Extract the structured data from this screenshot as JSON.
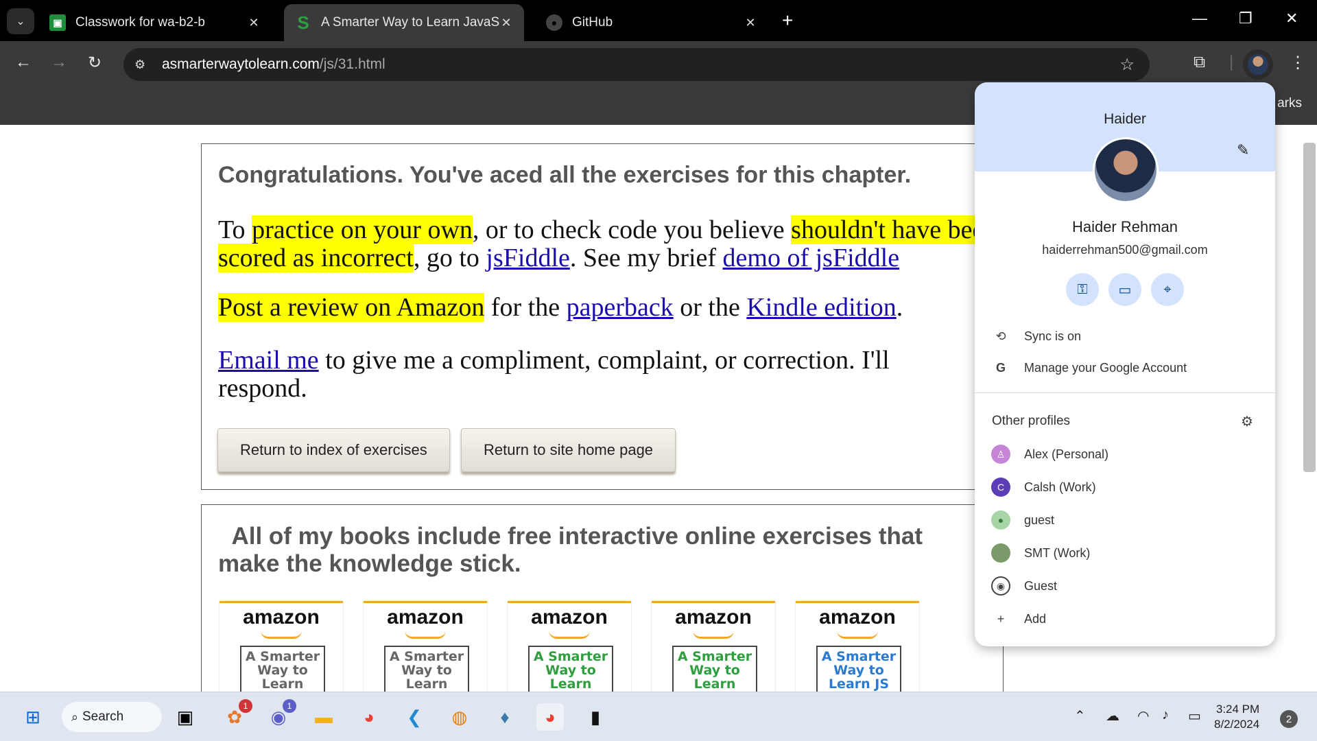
{
  "tabs": [
    {
      "title": "Classwork for wa-b2-b",
      "favicon": "classroom-icon"
    },
    {
      "title": "A Smarter Way to Learn JavaScr",
      "favicon": "s-icon"
    },
    {
      "title": "GitHub",
      "favicon": "github-icon"
    }
  ],
  "address": {
    "host": "asmarterwaytolearn.com",
    "path": "/js/31.html"
  },
  "bookmarks_label": "arks",
  "page": {
    "congrats": "Congratulations. You've aced all the exercises for this chapter.",
    "p1": {
      "a": "To ",
      "hl1": "practice on your own",
      "b": ", or to check code you believe ",
      "hl2": "shouldn't have been scored as incorrect",
      "c": ", go to ",
      "link1": "jsFiddle",
      "d": ". See my brief ",
      "link2": "demo of jsFiddle"
    },
    "p2": {
      "hl": "Post a review on Amazon",
      "a": " for the ",
      "link1": "paperback",
      "b": " or the ",
      "link2": "Kindle edition",
      "c": "."
    },
    "p3": {
      "link": "Email me",
      "a": " to give me a compliment, complaint, or correction. I'll respond."
    },
    "btn_index": "Return to index of exercises",
    "btn_home": "Return to site home page",
    "books_title": "All of my books include free interactive online exercises that make the knowledge stick.",
    "books": [
      {
        "brand": "amazon",
        "cover": "A Smarter Way to Learn Python",
        "color": "#666666"
      },
      {
        "brand": "amazon",
        "cover": "A Smarter Way to Learn Python",
        "color": "#666666"
      },
      {
        "brand": "amazon",
        "cover": "A Smarter Way to Learn HTML & CSS",
        "color": "#2e9e3e"
      },
      {
        "brand": "amazon",
        "cover": "A Smarter Way to Learn HTML & CSS",
        "color": "#2e9e3e"
      },
      {
        "brand": "amazon",
        "cover": "A Smarter Way to Learn JS",
        "color": "#2a7bd0"
      }
    ]
  },
  "profile": {
    "header_name": "Haider",
    "full_name": "Haider Rehman",
    "email": "haiderrehman500@gmail.com",
    "sync": "Sync is on",
    "manage": "Manage your Google Account",
    "other_profiles": "Other profiles",
    "profiles": [
      {
        "name": "Alex (Personal)",
        "color": "#c785d8",
        "initial": ""
      },
      {
        "name": "Calsh (Work)",
        "color": "#5b3db5",
        "initial": "C"
      },
      {
        "name": "guest",
        "color": "#a8d5a8",
        "initial": ""
      },
      {
        "name": "SMT (Work)",
        "color": "#7a9a6a",
        "initial": ""
      },
      {
        "name": "Guest",
        "color": "#ffffff",
        "initial": ""
      }
    ],
    "add": "Add"
  },
  "taskbar": {
    "search": "Search",
    "badge1": "1",
    "badge2": "1",
    "time": "3:24 PM",
    "date": "8/2/2024",
    "notifications": "2"
  }
}
